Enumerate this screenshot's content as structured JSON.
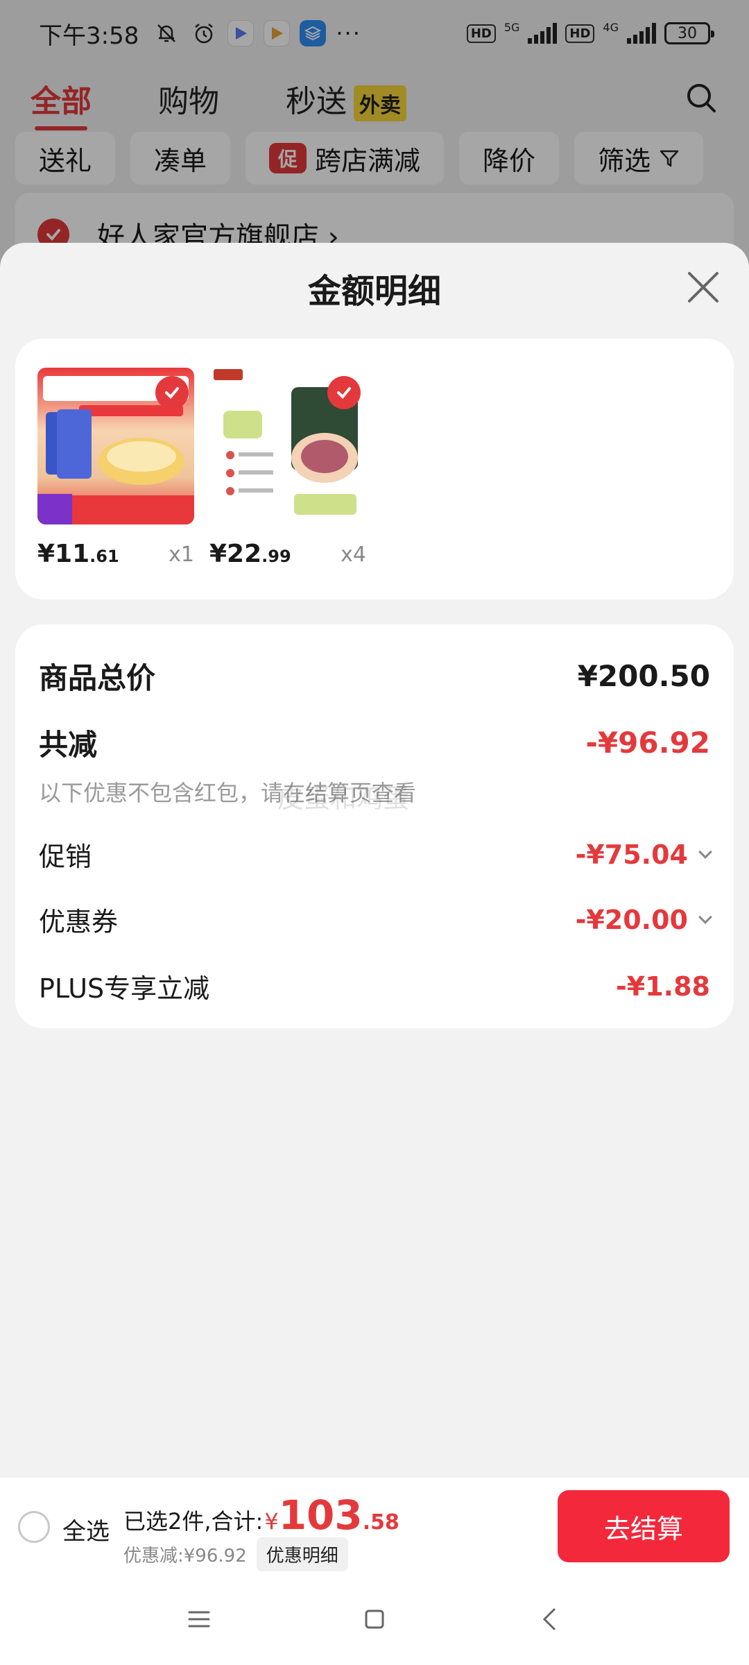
{
  "status_bar": {
    "time": "下午3:58",
    "battery": "30",
    "signal_5g": "5G",
    "signal_4g": "4G",
    "hd": "HD",
    "more": "···"
  },
  "top_nav": {
    "tabs": [
      {
        "label": "全部"
      },
      {
        "label": "购物"
      },
      {
        "label": "秒送"
      }
    ],
    "badge": "外卖"
  },
  "filters": {
    "items": [
      "送礼",
      "凑单",
      "跨店满减",
      "降价",
      "筛选"
    ],
    "promo_badge": "促"
  },
  "store": {
    "name": "好人家官方旗舰店 ›"
  },
  "sheet": {
    "title": "金额明细",
    "products": [
      {
        "price_int": "¥11",
        "price_dec": ".61",
        "qty": "x1"
      },
      {
        "price_int": "¥22",
        "price_dec": ".99",
        "qty": "x4"
      }
    ],
    "summary": {
      "goods_total_label": "商品总价",
      "goods_total_value": "¥200.50",
      "total_reduce_label": "共减",
      "total_reduce_value": "-¥96.92",
      "note": "以下优惠不包含红包，请在结算页查看",
      "promotion_label": "促销",
      "promotion_value": "-¥75.04",
      "coupon_label": "优惠券",
      "coupon_value": "-¥20.00",
      "plus_label": "PLUS专享立减",
      "plus_value": "-¥1.88"
    }
  },
  "bottom_bar": {
    "select_all": "全选",
    "selected_text": "已选2件,合计:",
    "currency": "¥",
    "total_int": "103",
    "total_dec": ".58",
    "discount_text": "优惠减:¥96.92",
    "detail_button": "优惠明细",
    "checkout_button": "去结算"
  },
  "watermark": "皮蛋和鸡蛋"
}
